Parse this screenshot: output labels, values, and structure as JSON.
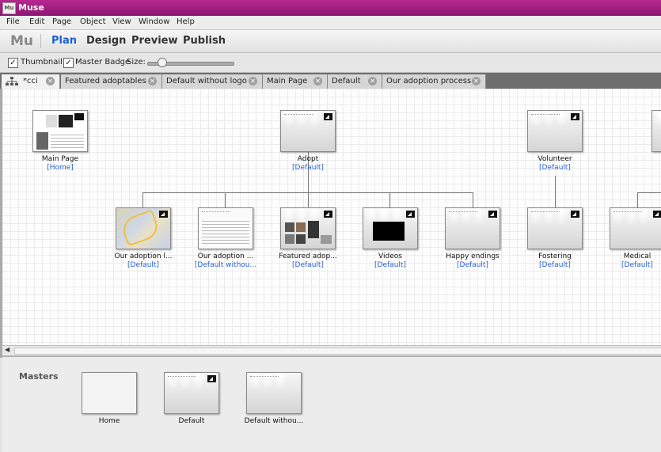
{
  "app": {
    "title": "Muse",
    "icon_label": "Mu"
  },
  "menu": [
    "File",
    "Edit",
    "Page",
    "Object",
    "View",
    "Window",
    "Help"
  ],
  "modebar": {
    "logo": "Mu",
    "modes": [
      "Plan",
      "Design",
      "Preview",
      "Publish"
    ],
    "active": "Plan"
  },
  "options": {
    "thumbnail_label": "Thumbnail",
    "thumbnail_checked": true,
    "master_badge_label": "Master Badge",
    "master_badge_checked": true,
    "size_label": "Size:",
    "size_value": 0.12
  },
  "tabs": [
    {
      "label": "*cci",
      "active": true
    },
    {
      "label": "Featured adoptables",
      "active": false
    },
    {
      "label": "Default without logo",
      "active": false
    },
    {
      "label": "Main Page",
      "active": false
    },
    {
      "label": "Default",
      "active": false
    },
    {
      "label": "Our adoption process",
      "active": false
    }
  ],
  "sitemap": {
    "top": [
      {
        "name": "Main Page",
        "master": "[Home]",
        "thumb": "home"
      },
      {
        "name": "Adopt",
        "master": "[Default]",
        "thumb": "default"
      },
      {
        "name": "Volunteer",
        "master": "[Default]",
        "thumb": "default"
      },
      {
        "name": "",
        "master": "",
        "thumb": "default"
      }
    ],
    "children": [
      {
        "name": "Our adoption l...",
        "master": "[Default]",
        "thumb": "map"
      },
      {
        "name": "Our adoption ...",
        "master": "[Default withou...",
        "thumb": "text"
      },
      {
        "name": "Featured adop...",
        "master": "[Default]",
        "thumb": "photos"
      },
      {
        "name": "Videos",
        "master": "[Default]",
        "thumb": "video"
      },
      {
        "name": "Happy endings",
        "master": "[Default]",
        "thumb": "default"
      },
      {
        "name": "Fostering",
        "master": "[Default]",
        "thumb": "default"
      },
      {
        "name": "Medical",
        "master": "[Default]",
        "thumb": "default"
      }
    ]
  },
  "masters": {
    "title": "Masters",
    "items": [
      {
        "name": "Home",
        "thumb": "blank"
      },
      {
        "name": "Default",
        "thumb": "default"
      },
      {
        "name": "Default withou...",
        "thumb": "nologo"
      }
    ]
  },
  "colors": {
    "titlebar": "#9b1d80",
    "active_mode": "#1a5fd4",
    "master_link": "#2a62d6"
  }
}
